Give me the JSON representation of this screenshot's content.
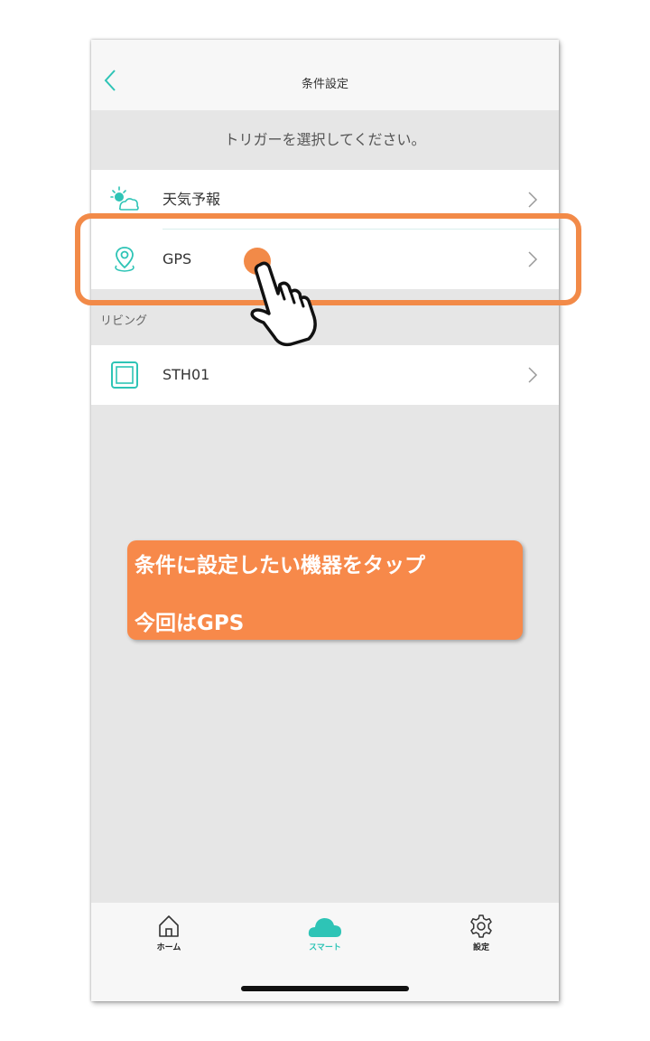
{
  "nav": {
    "title": "条件設定"
  },
  "prompt": "トリガーを選択してください。",
  "triggers": [
    {
      "icon": "weather-forecast-icon",
      "label": "天気予報"
    },
    {
      "icon": "location-pin-icon",
      "label": "GPS"
    }
  ],
  "section": {
    "title": "リビング"
  },
  "devices": [
    {
      "icon": "device-square-icon",
      "label": "STH01"
    }
  ],
  "tabs": [
    {
      "icon": "home-icon",
      "label": "ホーム"
    },
    {
      "icon": "cloud-icon",
      "label": "スマート",
      "active": true
    },
    {
      "icon": "gear-icon",
      "label": "設定"
    }
  ],
  "callout": {
    "line1": "条件に設定したい機器をタップ",
    "line2": "今回はGPS"
  },
  "colors": {
    "accent": "#2ec4b6",
    "highlight": "#f28a48"
  }
}
